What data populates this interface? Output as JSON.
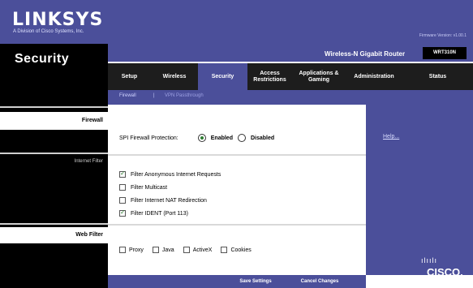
{
  "brand": {
    "logo": "LINKSYS",
    "subtitle": "A Division of Cisco Systems, Inc.",
    "firmware": "Firmware Version: v1.00.1"
  },
  "page_title": "Security",
  "router": {
    "name": "Wireless-N Gigabit Router",
    "model": "WRT310N"
  },
  "tabs": [
    {
      "label": "Setup"
    },
    {
      "label": "Wireless"
    },
    {
      "label": "Security"
    },
    {
      "label": "Access\nRestrictions"
    },
    {
      "label": "Applications &\nGaming"
    },
    {
      "label": "Administration"
    },
    {
      "label": "Status"
    }
  ],
  "subtabs": {
    "firewall": "Firewall",
    "separator": "|",
    "vpn": "VPN Passthrough"
  },
  "sections": {
    "firewall": "Firewall",
    "internet_filter": "Internet Filter",
    "web_filter": "Web Filter"
  },
  "firewall": {
    "label": "SPI Firewall Protection:",
    "enabled_label": "Enabled",
    "disabled_label": "Disabled",
    "selected": "Enabled"
  },
  "internet_filter": {
    "items": [
      {
        "label": "Filter Anonymous Internet Requests",
        "checked": true
      },
      {
        "label": "Filter Multicast",
        "checked": false
      },
      {
        "label": "Filter Internet NAT Redirection",
        "checked": false
      },
      {
        "label": "Filter IDENT (Port 113)",
        "checked": true
      }
    ]
  },
  "web_filter": {
    "items": [
      {
        "label": "Proxy",
        "checked": false
      },
      {
        "label": "Java",
        "checked": false
      },
      {
        "label": "ActiveX",
        "checked": false
      },
      {
        "label": "Cookies",
        "checked": false
      }
    ]
  },
  "help": {
    "link": "Help..."
  },
  "footer": {
    "save": "Save Settings",
    "cancel": "Cancel Changes"
  },
  "cisco": {
    "bars": "ılıılı",
    "word": "CISCO."
  }
}
